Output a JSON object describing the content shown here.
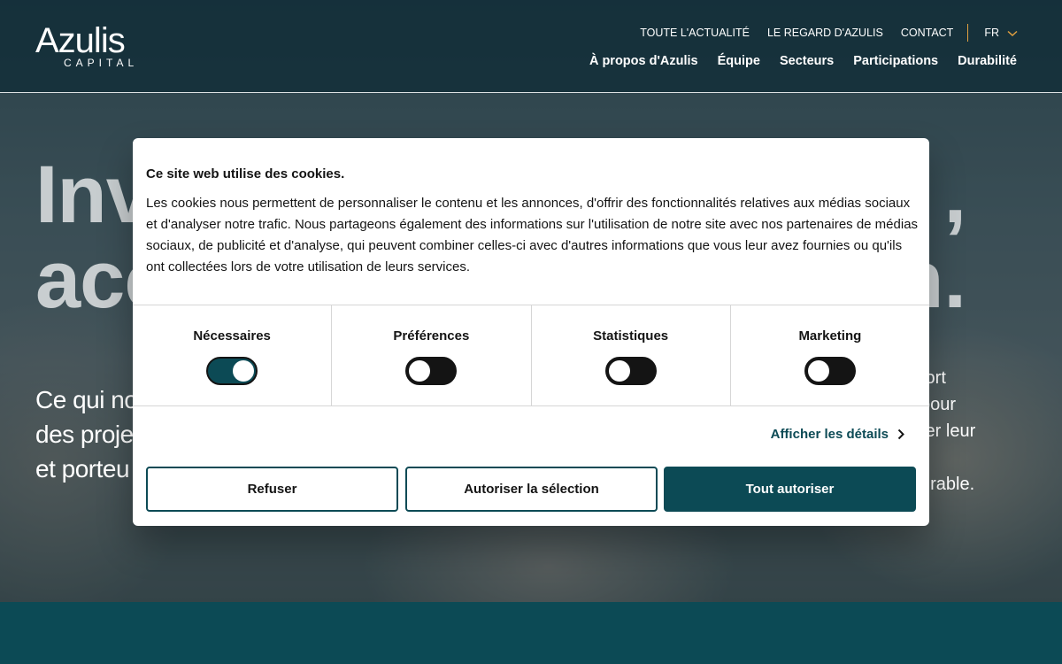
{
  "colors": {
    "accent": "#0c4a55",
    "divider_accent": "#e0a040",
    "text": "#141414"
  },
  "header": {
    "logo": {
      "name": "Azulis",
      "sub": "CAPITAL"
    },
    "top_links": [
      "TOUTE L'ACTUALITÉ",
      "LE REGARD D'AZULIS",
      "CONTACT"
    ],
    "language": "FR",
    "main_nav": [
      "À propos d'Azulis",
      "Équipe",
      "Secteurs",
      "Participations",
      "Durabilité"
    ]
  },
  "hero": {
    "title_line1": "Inv",
    "title_line2": "acc",
    "title_end1": ",",
    "title_end2": "n.",
    "text_left": [
      "Ce qui no",
      "des proje",
      "et porteu"
    ],
    "text_right": [
      "fort",
      "pour",
      "ter leur",
      "",
      "urable."
    ]
  },
  "cookie": {
    "title": "Ce site web utilise des cookies.",
    "body": "Les cookies nous permettent de personnaliser le contenu et les annonces, d'offrir des fonctionnalités relatives aux médias sociaux et d'analyser notre trafic. Nous partageons également des informations sur l'utilisation de notre site avec nos partenaires de médias sociaux, de publicité et d'analyse, qui peuvent combiner celles-ci avec d'autres informations que vous leur avez fournies ou qu'ils ont collectées lors de votre utilisation de leurs services.",
    "categories": [
      {
        "label": "Nécessaires",
        "enabled": true
      },
      {
        "label": "Préférences",
        "enabled": false
      },
      {
        "label": "Statistiques",
        "enabled": false
      },
      {
        "label": "Marketing",
        "enabled": false
      }
    ],
    "details_label": "Afficher les détails",
    "buttons": {
      "refuse": "Refuser",
      "allow_selection": "Autoriser la sélection",
      "allow_all": "Tout autoriser"
    }
  }
}
